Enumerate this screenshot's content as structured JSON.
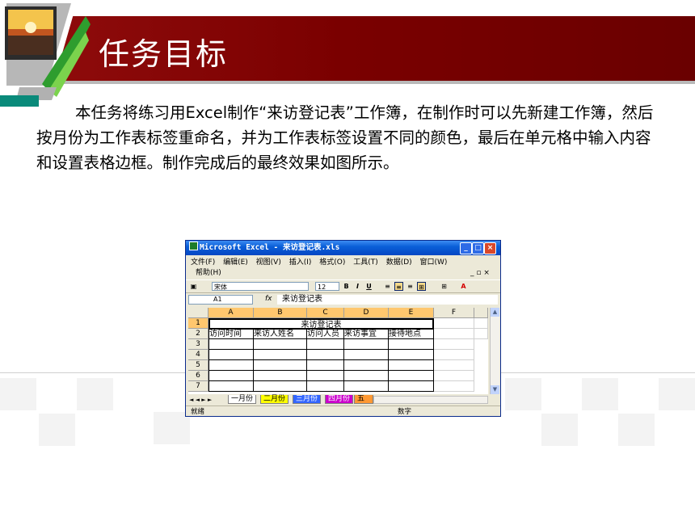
{
  "page": {
    "title": "任务目标",
    "body": "本任务将练习用Excel制作“来访登记表”工作簿，在制作时可以先新建工作簿，然后按月份为工作表标签重命名，并为工作表标签设置不同的颜色，最后在单元格中输入内容和设置表格边框。制作完成后的最终效果如图所示。",
    "accent_color": "#7a0000"
  },
  "excel": {
    "title": "Microsoft Excel - 来访登记表.xls",
    "window_buttons": {
      "minimize": "_",
      "maximize": "□",
      "close": "×"
    },
    "menu_row1": [
      "文件(F)",
      "编辑(E)",
      "视图(V)",
      "插入(I)",
      "格式(O)",
      "工具(T)",
      "数据(D)",
      "窗口(W)"
    ],
    "menu_row2": [
      "帮助(H)"
    ],
    "doc_controls": "_ ▫ ×",
    "font_name": "宋体",
    "font_size": "12",
    "toolbar_buttons": [
      "B",
      "I",
      "U"
    ],
    "name_box": "A1",
    "fx": "fx",
    "formula": "来访登记表",
    "columns": [
      "A",
      "B",
      "C",
      "D",
      "E",
      "F"
    ],
    "rows": [
      "1",
      "2",
      "3",
      "4",
      "5",
      "6",
      "7"
    ],
    "title_cell": "来访登记表",
    "headers": [
      "访问时间",
      "来访人姓名",
      "访问人员",
      "来访事宜",
      "接待地点"
    ],
    "sheet_nav": "◄ ◄ ► ►",
    "sheets": [
      {
        "name": "一月份",
        "color": "#ffffff"
      },
      {
        "name": "二月份",
        "color": "#ffff00"
      },
      {
        "name": "三月份",
        "color": "#3366ff"
      },
      {
        "name": "四月份",
        "color": "#cc00cc"
      },
      {
        "name": "五月",
        "color": "#ff9933"
      }
    ],
    "status_left": "就绪",
    "status_mid": "数字"
  }
}
